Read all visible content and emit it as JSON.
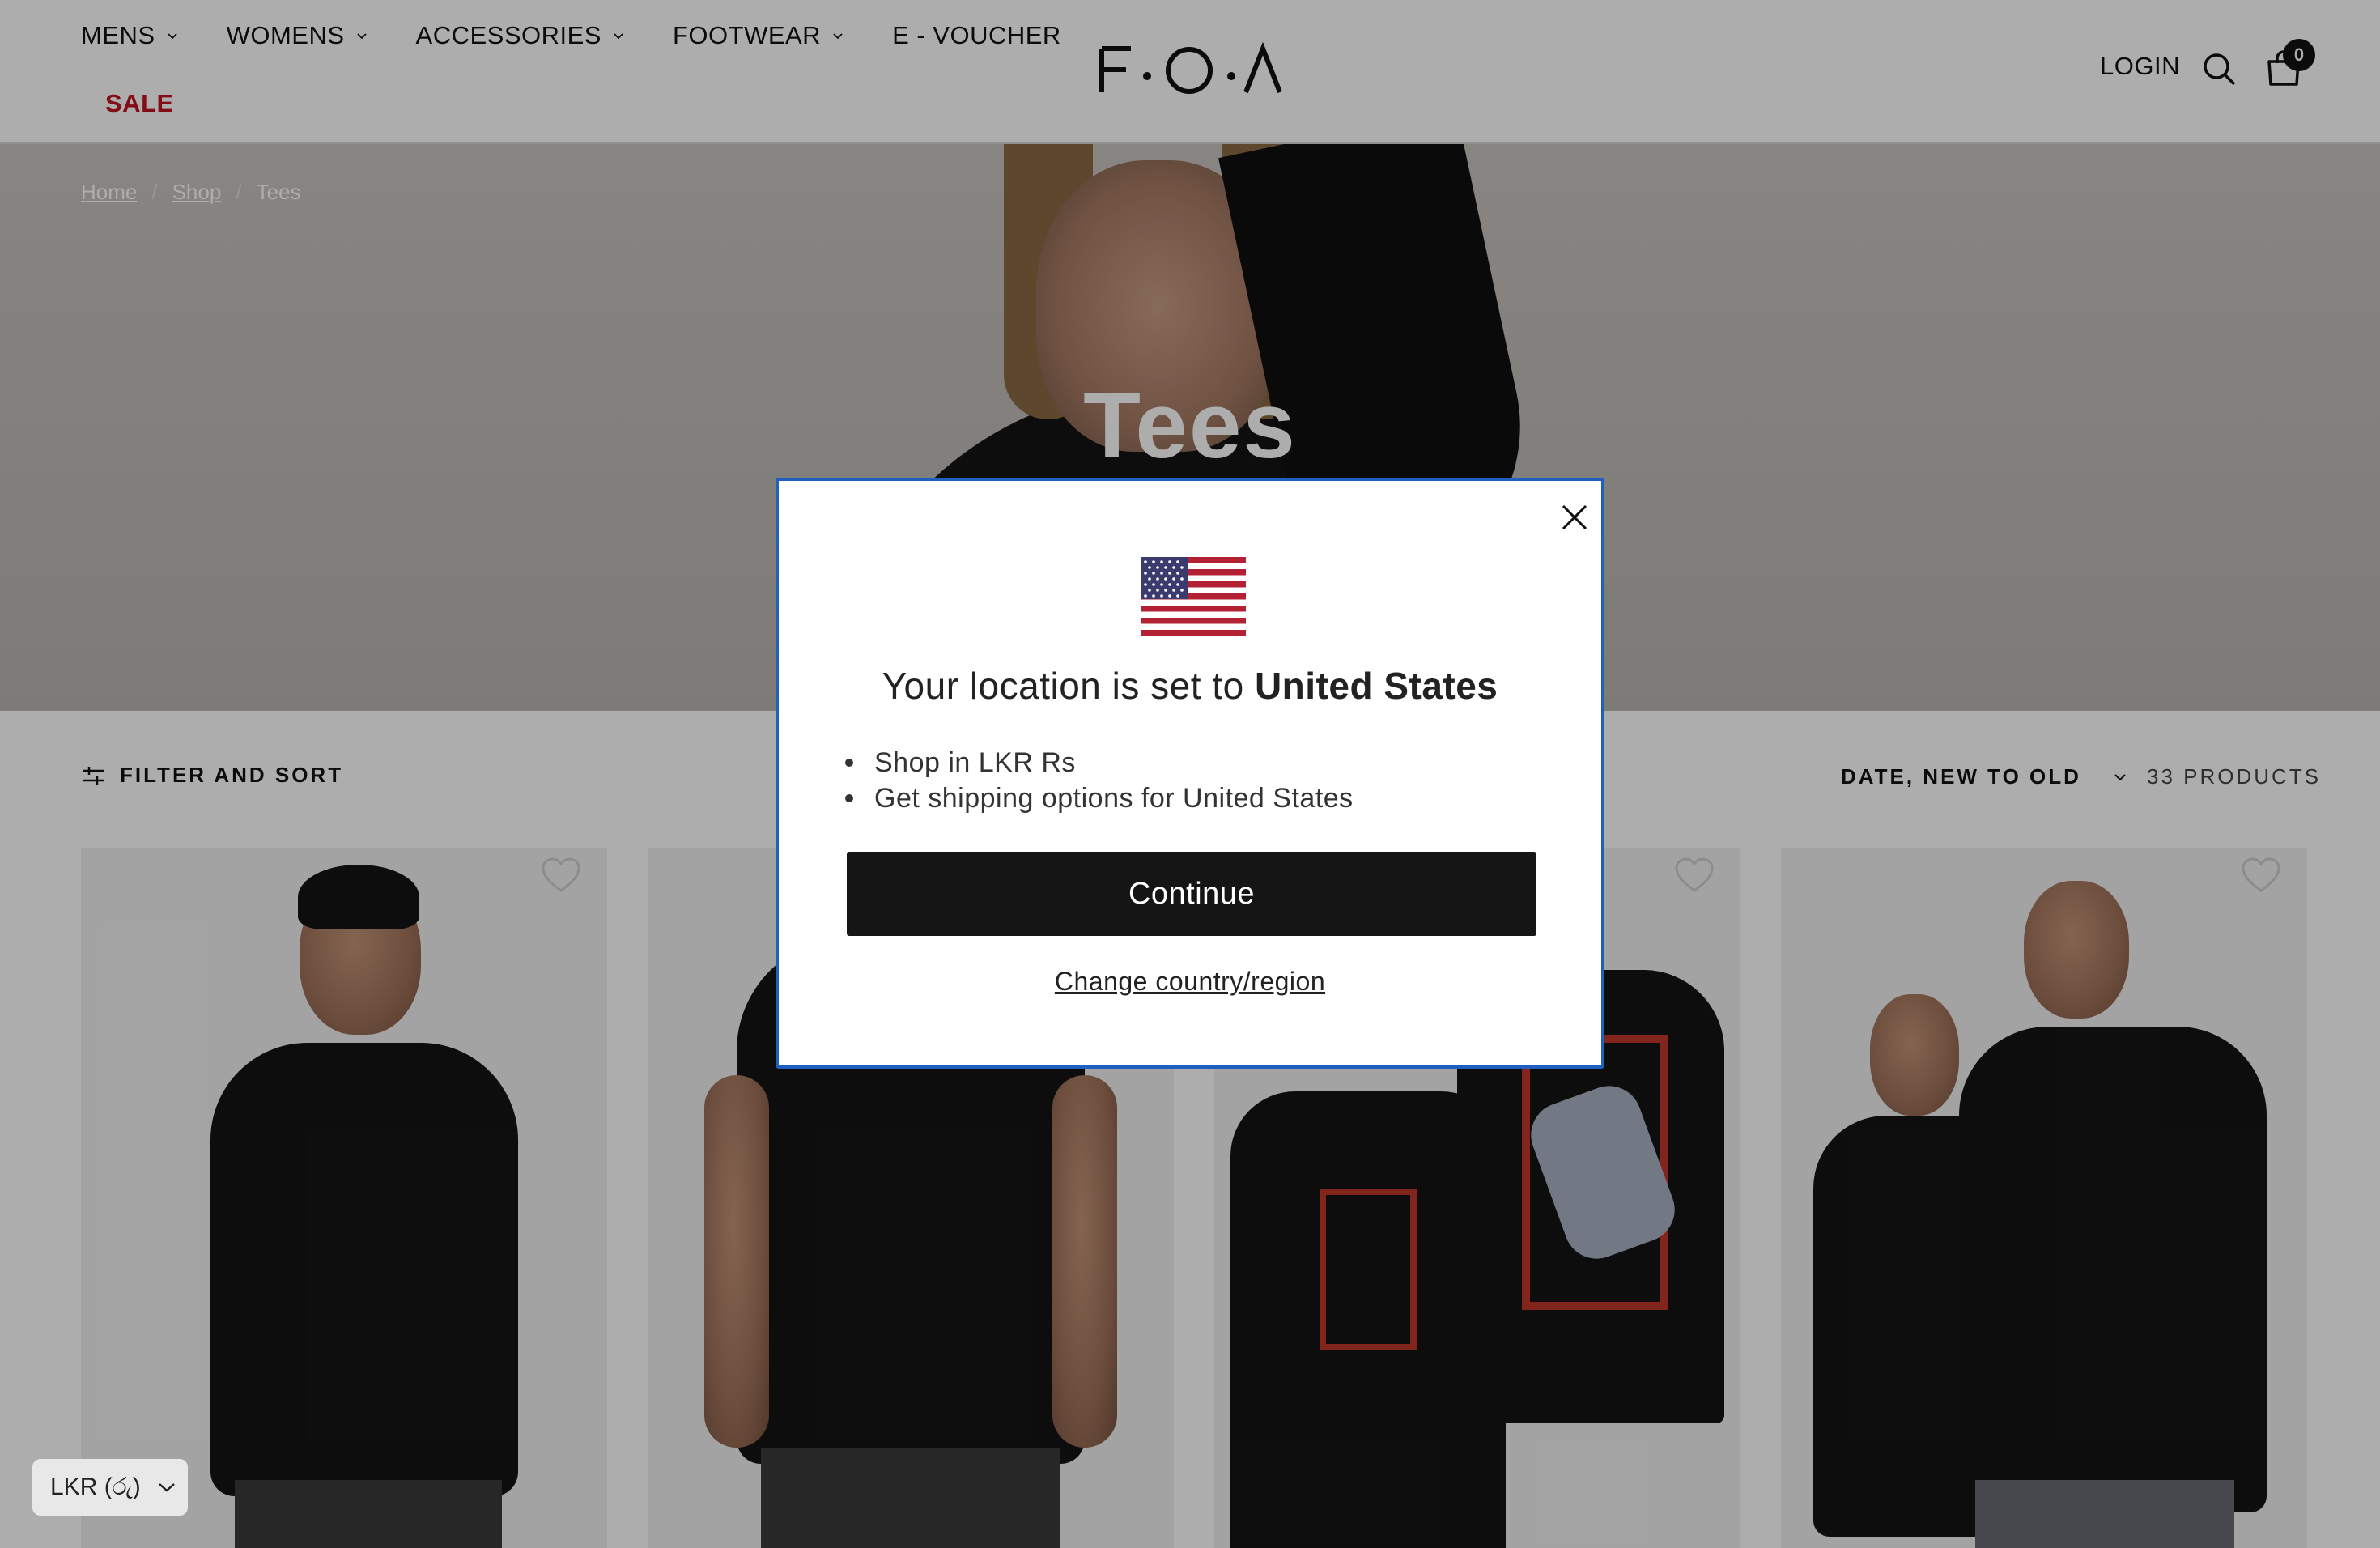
{
  "header": {
    "nav": [
      {
        "label": "MENS",
        "has_dropdown": true
      },
      {
        "label": "WOMENS",
        "has_dropdown": true
      },
      {
        "label": "ACCESSORIES",
        "has_dropdown": true
      },
      {
        "label": "FOOTWEAR",
        "has_dropdown": true
      },
      {
        "label": "E - VOUCHER",
        "has_dropdown": false
      }
    ],
    "sale_label": "SALE",
    "logo_text": "F·O·Λ",
    "login_label": "LOGIN",
    "cart_count": "0"
  },
  "breadcrumb": [
    {
      "label": "Home",
      "link": true
    },
    {
      "label": "Shop",
      "link": true
    },
    {
      "label": "Tees",
      "link": false
    }
  ],
  "hero": {
    "title": "Tees"
  },
  "toolbar": {
    "filter_label": "FILTER AND SORT",
    "sort_label": "DATE, NEW TO OLD",
    "count_label": "33 PRODUCTS"
  },
  "modal": {
    "title_prefix": "Your location is set to ",
    "title_country": "United States",
    "bullets": [
      "Shop in LKR Rs",
      "Get shipping options for United States"
    ],
    "continue_label": "Continue",
    "change_label": "Change country/region"
  },
  "currency": {
    "label": "LKR (රු)"
  },
  "colors": {
    "accent_sale": "#c1121f",
    "modal_border": "#1f5fbf",
    "button_bg": "#151515"
  }
}
